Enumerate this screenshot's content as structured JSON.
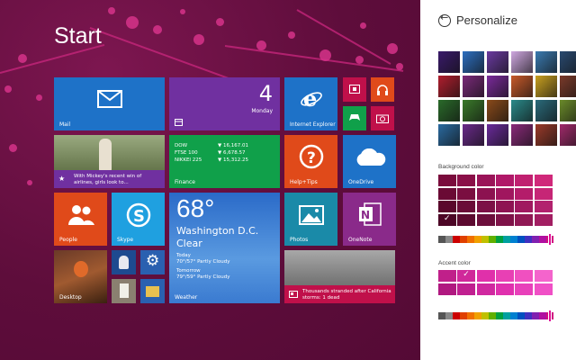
{
  "start": {
    "title": "Start",
    "tiles": {
      "mail": "Mail",
      "calendar_day": "4",
      "calendar_weekday": "Monday",
      "ie": "Internet Explorer",
      "news_headline": "With Mickey's recent win of airlines, girls look to...",
      "finance": "Finance",
      "finance_rows": [
        {
          "name": "DOW",
          "value": "▼ 16,167.01"
        },
        {
          "name": "FTSE 100",
          "value": "▼ 6,678.57"
        },
        {
          "name": "NIKKEI 225",
          "value": "▼ 15,312.25"
        }
      ],
      "help": "Help+Tips",
      "onedrive": "OneDrive",
      "people": "People",
      "skype": "Skype",
      "weather_temp": "68°",
      "weather_city": "Washington D.C.",
      "weather_cond": "Clear",
      "weather_today_label": "Today",
      "weather_today": "70°/57° Partly Cloudy",
      "weather_tomorrow_label": "Tomorrow",
      "weather_tomorrow": "79°/59° Partly Cloudy",
      "weather": "Weather",
      "photos": "Photos",
      "onenote": "OneNote",
      "desktop": "Desktop",
      "news2_headline": "Thousands stranded after California storms: 1 dead"
    }
  },
  "panel": {
    "title": "Personalize",
    "background_color_label": "Background color",
    "accent_color_label": "Accent color",
    "pattern_colors": [
      "#3a1a6a",
      "#2d6fc0",
      "#6a3aa0",
      "#cfa8e0",
      "#3a7ab0",
      "#2a4a70",
      "#b01e2e",
      "#7a2a7a",
      "#7a2a9a",
      "#c85a2a",
      "#c8a020",
      "#7a3a2a",
      "#2a6a2a",
      "#3a7a2a",
      "#8a4a1a",
      "#2a8a8a",
      "#2a6a7a",
      "#6a8a2a",
      "#2a6aa0",
      "#6a2a8a",
      "#6a2a9a",
      "#8a2a7a",
      "#9a3a2a",
      "#a02a6a"
    ],
    "background_swatches": [
      "#7a0c3c",
      "#8a1048",
      "#9a1458",
      "#b01868",
      "#c02070",
      "#d0287a",
      "#6a0a34",
      "#7a0e40",
      "#8c1250",
      "#a0165e",
      "#b41c6a",
      "#c62676",
      "#5a082c",
      "#6a0c38",
      "#7c1046",
      "#8e1452",
      "#a01a60",
      "#b2226e",
      "#4c0626",
      "#5c0a30",
      "#6c0e3c",
      "#7e1248",
      "#901854",
      "#a21e62"
    ],
    "accent_swatches": [
      "#c0208a",
      "#d0289a",
      "#e030aa",
      "#e840b4",
      "#f050c0",
      "#f464cc",
      "#b01880",
      "#c02090",
      "#d028a0",
      "#e030ae",
      "#e840ba",
      "#f050c6"
    ],
    "hue_colors": [
      "#555",
      "#888",
      "#c00",
      "#e04000",
      "#f07000",
      "#f0a000",
      "#c0c000",
      "#60b000",
      "#00a040",
      "#00a0a0",
      "#0080d0",
      "#0050c0",
      "#4030c0",
      "#8020b0",
      "#b010a0",
      "#d01080"
    ]
  },
  "colors": {
    "mail": "#1e72c8",
    "calendar": "#7030a0",
    "ie": "#1e72c8",
    "finance": "#10a04a",
    "help": "#e04a1a",
    "onedrive": "#1e72c8",
    "people": "#e04a1a",
    "skype": "#1fa0e0",
    "weather": "#2a7ad0",
    "photos": "#1a8aa8",
    "onenote": "#8a2a8a",
    "small_red": "#c0104a"
  }
}
